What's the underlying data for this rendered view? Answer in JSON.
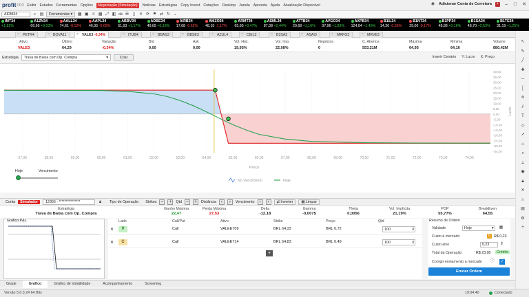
{
  "app": {
    "logo": "profit",
    "edition": "PRO",
    "account_label": "Adicionar Conta de Corretora"
  },
  "menu": [
    "Exibir",
    "Estudos",
    "Ferramentas",
    "Opções",
    "Negociação (Simulação)",
    "Notícias",
    "Estratégias",
    "Copy Invest",
    "Cotações",
    "Desktop",
    "Janela",
    "Aprenda",
    "Ajuda",
    "Atualização Disponível"
  ],
  "toolbar": {
    "asset": "AIDM34",
    "tools_label": "Ferramentas",
    "ok_label": "ok"
  },
  "ticker": [
    {
      "name": "IMT34",
      "chg": "+1,82%",
      "up": true,
      "price": ""
    },
    {
      "name": "A1ZN34",
      "price": "66,66",
      "chg": "+0,03%",
      "up": true
    },
    {
      "name": "AALL34",
      "price": "74,61",
      "chg": "-0,12%",
      "up": false
    },
    {
      "name": "AAPL34",
      "price": "46,95",
      "chg": "-0,69%",
      "up": false
    },
    {
      "name": "ABBV34",
      "price": "51,93",
      "chg": "+1,17%",
      "up": true
    },
    {
      "name": "ADBE34",
      "price": "49,69",
      "chg": "+0,18%",
      "up": true
    },
    {
      "name": "AIRB34",
      "price": "17,68",
      "chg": "-0,62%",
      "up": false
    },
    {
      "name": "AMZO34",
      "price": "48,10",
      "chg": "-1,17%",
      "up": false
    },
    {
      "name": "ARMT34",
      "price": "65,95",
      "chg": "+0,47%",
      "up": true
    },
    {
      "name": "ASML34",
      "price": "87,38",
      "chg": "+2,44%",
      "up": true
    },
    {
      "name": "ATTB34",
      "price": "29,68",
      "chg": "+1,16%",
      "up": true
    },
    {
      "name": "AVGO34",
      "price": "97,96",
      "chg": "+1,83%",
      "up": true
    },
    {
      "name": "AXPB34",
      "price": "124,84",
      "chg": "+1,45%",
      "up": true
    },
    {
      "name": "B1IL34",
      "price": "14,30",
      "chg": "-0,56%",
      "up": false
    },
    {
      "name": "B1NT34",
      "price": "29,06",
      "chg": "-0,17%",
      "up": false
    },
    {
      "name": "B1PP34",
      "price": "48,88",
      "chg": "+0,16%",
      "up": true
    },
    {
      "name": "B1SA34",
      "price": "48,70",
      "chg": "+2,53%",
      "up": true
    },
    {
      "name": "B1TE34",
      "price": "31,19",
      "chg": "+1,25%",
      "up": true
    }
  ],
  "tabs": [
    {
      "label": "PETR4",
      "chg": ""
    },
    {
      "label": "BOVA11",
      "chg": ""
    },
    {
      "label": "VALE3",
      "chg": "-0,34%"
    },
    {
      "label": "ITUB4",
      "chg": ""
    },
    {
      "label": "BBAS3",
      "chg": ""
    },
    {
      "label": "BBSE3",
      "chg": ""
    },
    {
      "label": "AZUL4",
      "chg": ""
    },
    {
      "label": "CIEL3",
      "chg": ""
    },
    {
      "label": "B3SA3",
      "chg": ""
    },
    {
      "label": "ASAI3",
      "chg": ""
    },
    {
      "label": "MRFG3",
      "chg": ""
    },
    {
      "label": "MRVE3",
      "chg": ""
    }
  ],
  "quote": {
    "headers": [
      "Ativo",
      "Último",
      "Variação",
      "Bid",
      "Ask",
      "Vol. Hist.",
      "Vol. Imp.",
      "Negócios",
      "C. Abertos",
      "Máxima",
      "Mínima",
      "Volume"
    ],
    "values": [
      "VALE3",
      "64,29",
      "-0,34%",
      "0,00",
      "0,00",
      "19,95%",
      "22,08%",
      "0",
      "553,21M",
      "64,95",
      "64,16",
      "880,42M"
    ]
  },
  "strategy": {
    "label": "Estratégia",
    "value": "Trava de Baixa com Op. Compra",
    "create": "Criar",
    "scenario": "Inserir Cenário",
    "y_axis": "Y: Lucro",
    "x_axis": "X: Preço"
  },
  "chart_data": {
    "type": "line",
    "xlabel": "Preço",
    "ylabel": "Lucro",
    "x_ticks": [
      "57,00",
      "58,00",
      "59,00",
      "60,00",
      "61,00",
      "62,00",
      "63,00",
      "64,00",
      "65,00",
      "66,00",
      "67,00",
      "68,00",
      "69,00",
      "70,00",
      "71,00",
      "72,00",
      "73,00",
      "74,00"
    ],
    "y_ticks": [
      "40,00",
      "35,00",
      "30,00",
      "25,00",
      "20,00",
      "15,00",
      "10,00",
      "5,00",
      "0,00",
      "-5,00",
      "-10,00",
      "-15,00",
      "-20,00",
      "-25,00",
      "-30,00",
      "-35,00"
    ],
    "xlim": [
      56.3,
      74.8
    ],
    "ylim": [
      -37,
      42
    ],
    "series": [
      {
        "name": "No Vencimento",
        "color": "#e03030",
        "x": [
          56.3,
          64.33,
          64.83,
          74.8
        ],
        "y": [
          22.47,
          22.47,
          -27.53,
          -27.53
        ]
      },
      {
        "name": "Hoje",
        "color": "#2aa050",
        "x": [
          56.3,
          60,
          61,
          62,
          62.5,
          63,
          63.5,
          64,
          64.5,
          65,
          65.5,
          66,
          67,
          68,
          70,
          72,
          74.8
        ],
        "y": [
          22.4,
          22.2,
          21.3,
          19.0,
          16.5,
          12.7,
          7.8,
          2.0,
          -4.1,
          -10.0,
          -15.0,
          -19.2,
          -23.6,
          -25.8,
          -27.0,
          -27.3,
          -27.4
        ]
      }
    ],
    "markers": [
      {
        "x": 64.33,
        "y": 22.47
      },
      {
        "x": 64.83,
        "y": -4.5
      }
    ],
    "current_price_x": 64.29,
    "profit_color": "#bcd7f3",
    "loss_color": "#f8c6c6"
  },
  "slider": {
    "today": "Hoje",
    "expiry": "Vencimento"
  },
  "params": {
    "conta": "Conta",
    "sim": "Simulador",
    "account": "12366 - ***************",
    "op_type": "Tipo de Operação",
    "strikes": "Strikes",
    "qtd": "Qtd",
    "dist": "Distância",
    "venc": "Vencimento",
    "invert": "Inverter",
    "clear": "Limpar"
  },
  "summary": {
    "headers": [
      "Estratégia",
      "Ganho Máxima",
      "Perda Máxima",
      "Delta",
      "Gamma",
      "Theta",
      "Vol. Implícita",
      "POP",
      "BreakEven"
    ],
    "values": [
      "Trava de Baixa com Op. Compra",
      "22,47",
      "27,53",
      "-12,18",
      "-0,0075",
      "0,0056",
      "21,19%",
      "55,77%",
      "64,55"
    ]
  },
  "pnl": {
    "title": "Gráfico P&L"
  },
  "legs": {
    "headers": [
      "Lado",
      "Call/Put",
      "Ativo",
      "Strike",
      "Preço",
      "Qtd"
    ],
    "rows": [
      {
        "side": "V",
        "type": "Call",
        "asset": "VALEE709",
        "strike": "BRL 64,33",
        "price": "BRL 0,72",
        "qty": "100"
      },
      {
        "side": "C",
        "type": "Call",
        "asset": "VALEE714",
        "strike": "BRL 64,83",
        "price": "BRL 0,49",
        "qty": "100"
      }
    ]
  },
  "order": {
    "title": "Resumo de Ordem",
    "validity_label": "Validade",
    "validity": "Hoje",
    "market_cost_label": "Custo à mercado",
    "market_cost": "R$ 0,23",
    "target_cost_label": "Custo alvo",
    "target_cost": "0,23",
    "total_label": "Total da Operação",
    "total": "R$ 23,00",
    "credit": "Crédito",
    "adjust_label": "Corrigir enviamento a mercado",
    "send": "Enviar Ordem"
  },
  "bottom_tabs": [
    "Grade",
    "Gráfico",
    "Gráfico de Volatilidade",
    "Acompanhamento",
    "Screening"
  ],
  "status": {
    "version": "Versão 5.0.3.24 64 Bits",
    "time": "19:04:40",
    "conn": "Conectado"
  }
}
